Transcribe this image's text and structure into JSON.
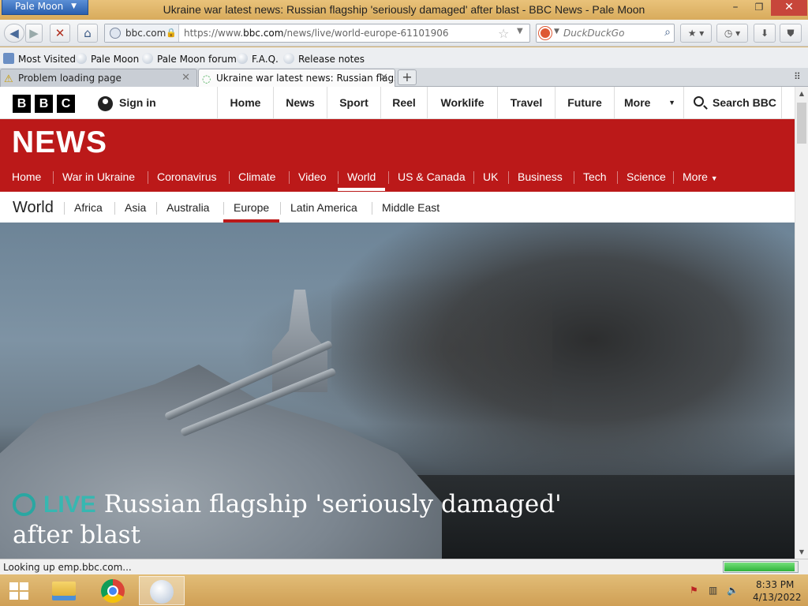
{
  "window": {
    "app_menu": "Pale Moon",
    "title": "Ukraine war latest news: Russian flagship 'seriously damaged' after blast - BBC News - Pale Moon",
    "controls": {
      "minimize": "–",
      "maximize": "❐",
      "close": "✕"
    }
  },
  "toolbar": {
    "identity": "bbc.com",
    "url_prefix": "https://www.",
    "url_domain": "bbc.com",
    "url_path": "/news/live/world-europe-61101906",
    "search_placeholder": "DuckDuckGo"
  },
  "bookmarks": [
    {
      "label": "Most Visited"
    },
    {
      "label": "Pale Moon"
    },
    {
      "label": "Pale Moon forum"
    },
    {
      "label": "F.A.Q."
    },
    {
      "label": "Release notes"
    }
  ],
  "tabs": [
    {
      "label": "Problem loading page",
      "icon": "warning-icon"
    },
    {
      "label": "Ukraine war latest news: Russian flags...",
      "icon": "loading-icon"
    }
  ],
  "bbc": {
    "logo": [
      "B",
      "B",
      "C"
    ],
    "signin": "Sign in",
    "nav": [
      "Home",
      "News",
      "Sport",
      "Reel",
      "Worklife",
      "Travel",
      "Future",
      "More"
    ],
    "search": "Search BBC"
  },
  "news": {
    "logo": "NEWS",
    "nav": [
      "Home",
      "War in Ukraine",
      "Coronavirus",
      "Climate",
      "Video",
      "World",
      "US & Canada",
      "UK",
      "Business",
      "Tech",
      "Science",
      "More"
    ],
    "active": "World"
  },
  "world": {
    "title": "World",
    "subnav": [
      "Africa",
      "Asia",
      "Australia",
      "Europe",
      "Latin America",
      "Middle East"
    ],
    "active": "Europe"
  },
  "hero": {
    "live": "LIVE",
    "headline": "Russian flagship 'seriously damaged' after blast"
  },
  "status": {
    "text": "Looking up emp.bbc.com...",
    "progress": 0.97
  },
  "clock": {
    "time": "8:33 PM",
    "date": "4/13/2022"
  },
  "colors": {
    "bbc_red": "#bb1919",
    "live_teal": "#37b7b1"
  }
}
